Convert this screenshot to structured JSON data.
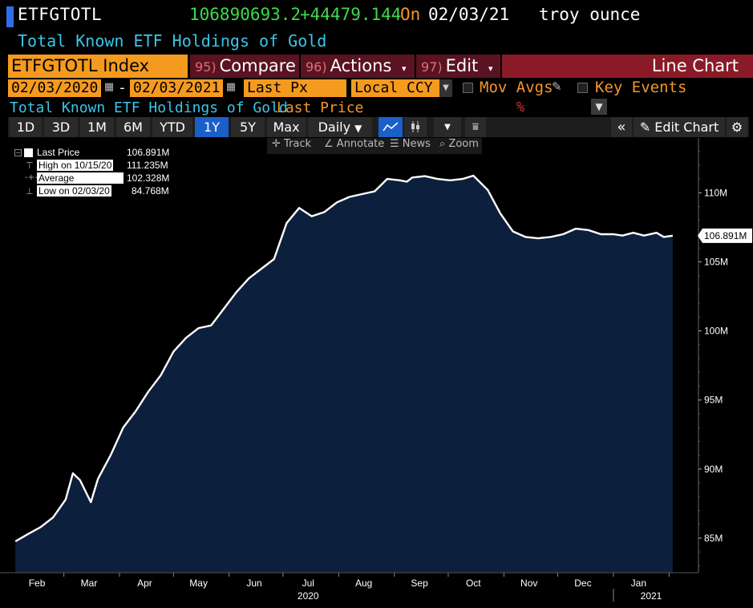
{
  "header": {
    "ticker": "ETFGTOTL",
    "price": "106890693.2",
    "change": "+44479.144",
    "on_label": "On",
    "on_date": "02/03/21",
    "unit": "troy ounce",
    "subtitle": "Total Known ETF Holdings of Gold"
  },
  "menu": {
    "index_label": "ETFGTOTL Index",
    "compare_num": "95)",
    "compare": "Compare",
    "actions_num": "96)",
    "actions": "Actions",
    "edit_num": "97)",
    "edit": "Edit",
    "line_chart": "Line Chart"
  },
  "params": {
    "start_date": "02/03/2020",
    "dash": "-",
    "end_date": "02/03/2021",
    "field": "Last Px",
    "currency": "Local CCY",
    "mov_avgs": "Mov Avgs",
    "key_events": "Key Events",
    "series_title": "Total Known ETF Holdings of Gold",
    "last_price": "Last Price",
    "percent": "%"
  },
  "toolbar": {
    "periods": [
      "1D",
      "3D",
      "1M",
      "6M",
      "YTD",
      "1Y",
      "5Y",
      "Max"
    ],
    "selected_period": "1Y",
    "frequency": "Daily",
    "edit_chart": "Edit Chart"
  },
  "chart_tools": {
    "track": "Track",
    "annotate": "Annotate",
    "news": "News",
    "zoom": "Zoom"
  },
  "legend": {
    "rows": [
      {
        "label": "Last Price",
        "value": "106.891M"
      },
      {
        "label": "High on 10/15/20",
        "value": "111.235M"
      },
      {
        "label": "Average",
        "value": "102.328M"
      },
      {
        "label": "Low on 02/03/20",
        "value": "84.768M"
      }
    ]
  },
  "colors": {
    "area_fill": "#0c1f3d",
    "line": "#ffffff",
    "accent_orange": "#f49a1f",
    "green": "#3fd94b",
    "cyan": "#39c6e8"
  },
  "chart_data": {
    "type": "area",
    "x": [
      "2020-02-03",
      "2020-02-10",
      "2020-02-17",
      "2020-02-24",
      "2020-03-02",
      "2020-03-06",
      "2020-03-10",
      "2020-03-16",
      "2020-03-20",
      "2020-03-27",
      "2020-04-03",
      "2020-04-10",
      "2020-04-17",
      "2020-04-24",
      "2020-05-01",
      "2020-05-08",
      "2020-05-15",
      "2020-05-22",
      "2020-05-29",
      "2020-06-05",
      "2020-06-12",
      "2020-06-19",
      "2020-06-26",
      "2020-07-03",
      "2020-07-10",
      "2020-07-17",
      "2020-07-24",
      "2020-07-31",
      "2020-08-07",
      "2020-08-14",
      "2020-08-21",
      "2020-08-28",
      "2020-09-04",
      "2020-09-08",
      "2020-09-11",
      "2020-09-18",
      "2020-09-25",
      "2020-10-02",
      "2020-10-09",
      "2020-10-15",
      "2020-10-23",
      "2020-10-30",
      "2020-11-06",
      "2020-11-13",
      "2020-11-20",
      "2020-11-27",
      "2020-12-04",
      "2020-12-11",
      "2020-12-18",
      "2020-12-25",
      "2021-01-01",
      "2021-01-06",
      "2021-01-12",
      "2021-01-18",
      "2021-01-25",
      "2021-01-29",
      "2021-02-03"
    ],
    "values": [
      84.77,
      85.3,
      85.8,
      86.5,
      87.8,
      89.7,
      89.2,
      87.6,
      89.3,
      91.0,
      93.0,
      94.2,
      95.6,
      96.8,
      98.5,
      99.5,
      100.2,
      100.4,
      101.6,
      102.8,
      103.8,
      104.5,
      105.2,
      107.8,
      108.9,
      108.3,
      108.6,
      109.3,
      109.7,
      109.9,
      110.1,
      111.0,
      110.9,
      110.8,
      111.1,
      111.2,
      111.0,
      110.9,
      111.0,
      111.235,
      110.2,
      108.5,
      107.2,
      106.8,
      106.7,
      106.8,
      107.0,
      107.4,
      107.3,
      107.0,
      107.0,
      106.9,
      107.1,
      106.9,
      107.1,
      106.8,
      106.891
    ],
    "series": [
      {
        "name": "Last Price"
      }
    ],
    "yticks": [
      "85M",
      "90M",
      "95M",
      "100M",
      "105M",
      "110M"
    ],
    "ylim": [
      82.5,
      113.5
    ],
    "xlim": [
      "2020-01-29",
      "2021-02-16"
    ],
    "months": [
      {
        "label": "Feb",
        "date": "2020-02-15"
      },
      {
        "label": "Mar",
        "date": "2020-03-15"
      },
      {
        "label": "Apr",
        "date": "2020-04-15"
      },
      {
        "label": "May",
        "date": "2020-05-15"
      },
      {
        "label": "Jun",
        "date": "2020-06-15"
      },
      {
        "label": "Jul",
        "date": "2020-07-15"
      },
      {
        "label": "Aug",
        "date": "2020-08-15"
      },
      {
        "label": "Sep",
        "date": "2020-09-15"
      },
      {
        "label": "Oct",
        "date": "2020-10-15"
      },
      {
        "label": "Nov",
        "date": "2020-11-15"
      },
      {
        "label": "Dec",
        "date": "2020-12-15"
      },
      {
        "label": "Jan",
        "date": "2021-01-15"
      }
    ],
    "year_labels": [
      {
        "label": "2020",
        "date": "2020-07-15"
      },
      {
        "label": "2021",
        "date": "2021-01-22"
      }
    ],
    "last_value_label": "106.891M",
    "last_value": 106.891
  }
}
